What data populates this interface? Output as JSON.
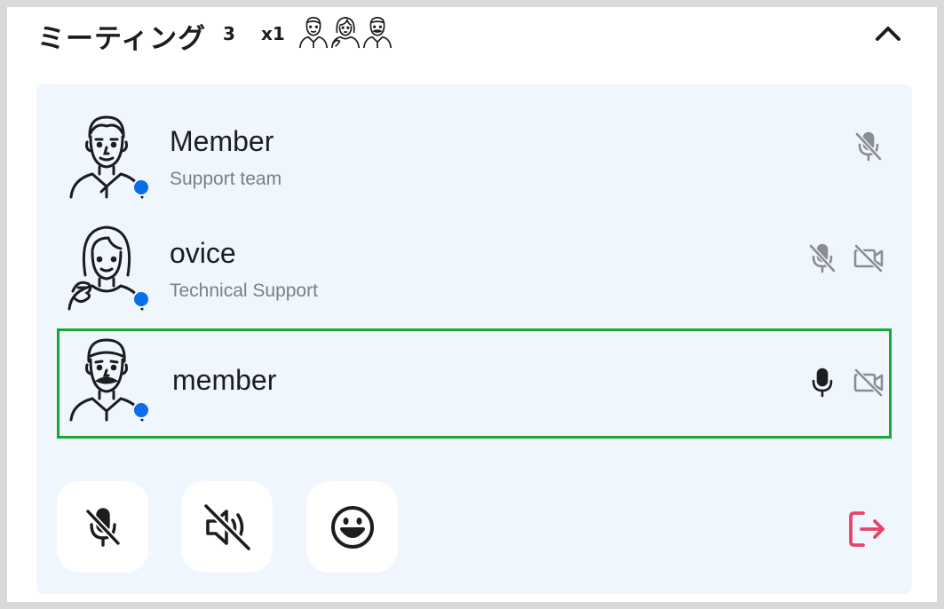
{
  "header": {
    "title": "ミーティング",
    "count": "3",
    "multiplier": "x1",
    "mini_avatars": [
      "man-avatar-icon",
      "woman-avatar-icon",
      "mustache-man-avatar-icon"
    ],
    "collapse_icon": "chevron-up-icon"
  },
  "members": [
    {
      "name": "Member",
      "role": "Support team",
      "avatar": "man-avatar-icon",
      "status": "online",
      "mic": "muted",
      "camera": "none"
    },
    {
      "name": "ovice",
      "role": "Technical Support",
      "avatar": "woman-avatar-icon",
      "status": "online",
      "mic": "muted",
      "camera": "off"
    },
    {
      "name": "member",
      "role": "",
      "avatar": "mustache-man-avatar-icon",
      "status": "online",
      "mic": "on",
      "camera": "off",
      "highlighted": true
    }
  ],
  "controls": {
    "mic": "mic-off-icon",
    "speaker": "speaker-off-icon",
    "reaction": "smiley-icon",
    "leave": "leave-icon"
  },
  "colors": {
    "panel_bg": "#eff6fe",
    "status_online": "#0a6ee8",
    "active_border": "#1aa632",
    "leave": "#e8436a",
    "icon_muted": "#8a8d92",
    "text": "#1d1d1f",
    "subtext": "#7b7f86"
  }
}
